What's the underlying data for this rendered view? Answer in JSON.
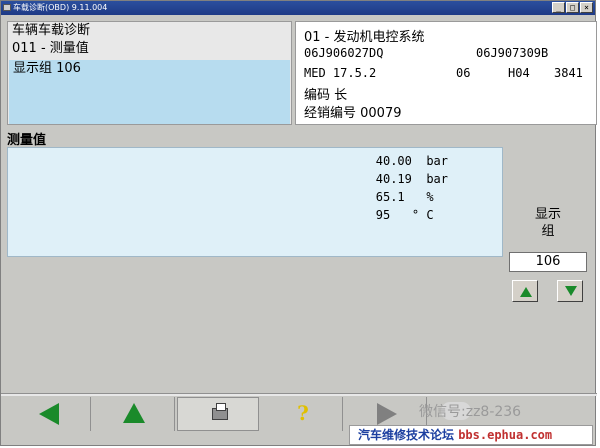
{
  "window": {
    "title": "车载诊断(OBD) 9.11.004",
    "min": "_",
    "max": "□",
    "close": "×"
  },
  "left_panel": {
    "title": "车辆车载诊断",
    "function": "011 - 测量值",
    "group": "显示组 106"
  },
  "ecu_info": {
    "system": "01 - 发动机电控系统",
    "part_no_1": "06J906027DQ",
    "part_no_2": "06J907309B",
    "engine": "MED 17.5.2",
    "val_06": "06",
    "val_h04": "H04",
    "val_3841": "3841",
    "coding": "编码 长",
    "dealer": "经销编号 00079"
  },
  "measurement": {
    "title": "测量值",
    "values": [
      {
        "text": "40.00  bar"
      },
      {
        "text": "40.19  bar"
      },
      {
        "text": "65.1   %  "
      },
      {
        "text": "95   ° C  "
      }
    ]
  },
  "group_control": {
    "label_1": "显示",
    "label_2": "组",
    "value": "106"
  },
  "watermark": {
    "text": "微信号:zz8-236"
  },
  "footer": {
    "text": "汽车维修技术论坛",
    "url": "bbs.ephua.com"
  },
  "colors": {
    "selection": "#b7dcef",
    "value_bg": "#dff0f8",
    "arrow_green": "#1a8a2a",
    "footer_blue": "#1c3fa0"
  }
}
